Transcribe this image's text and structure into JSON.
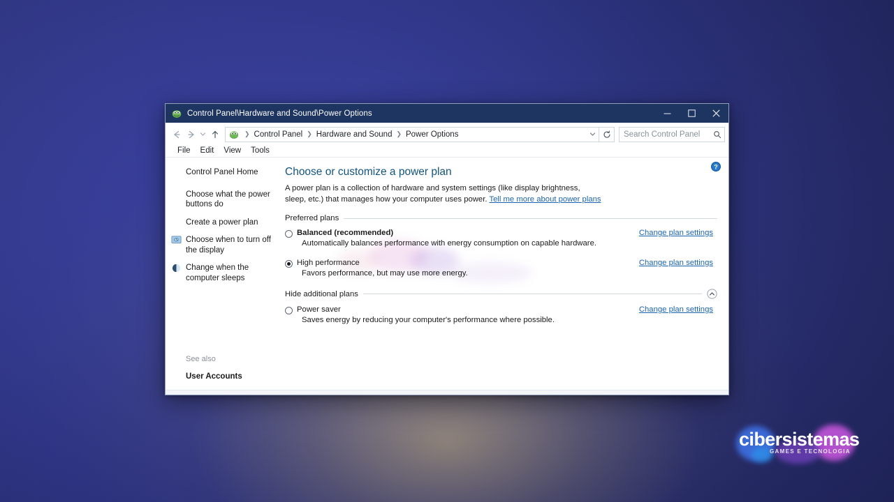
{
  "window": {
    "title": "Control Panel\\Hardware and Sound\\Power Options",
    "minimize_label": "─",
    "maximize_label": "☐",
    "close_label": "✕",
    "icon": "control-panel-icon"
  },
  "navigation": {
    "back": "←",
    "forward": "→",
    "recent": "∨",
    "up": "↑",
    "breadcrumb": [
      {
        "label": "Control Panel"
      },
      {
        "label": "Hardware and Sound"
      },
      {
        "label": "Power Options"
      }
    ],
    "separator": "❯",
    "address_dropdown": "∨",
    "refresh": "↻"
  },
  "search": {
    "placeholder": "Search Control Panel",
    "icon": "search-icon"
  },
  "menubar": [
    {
      "label": "File"
    },
    {
      "label": "Edit"
    },
    {
      "label": "View"
    },
    {
      "label": "Tools"
    }
  ],
  "sidebar": {
    "home": "Control Panel Home",
    "items": [
      {
        "label": "Choose what the power buttons do",
        "icon": "none"
      },
      {
        "label": "Create a power plan",
        "icon": "none"
      },
      {
        "label": "Choose when to turn off the display",
        "icon": "display-icon"
      },
      {
        "label": "Change when the computer sleeps",
        "icon": "sleep-moon-icon"
      }
    ],
    "see_also_label": "See also",
    "see_also_items": [
      {
        "label": "User Accounts"
      }
    ]
  },
  "main": {
    "help_icon": "help-question-icon",
    "title": "Choose or customize a power plan",
    "description_part1": "A power plan is a collection of hardware and system settings (like display brightness, sleep, etc.) that manages how your computer uses power. ",
    "description_link": "Tell me more about power plans",
    "preferred_section_label": "Preferred plans",
    "additional_section_label": "Hide additional plans",
    "collapse_icon": "chevron-up-circle-icon",
    "change_link_label": "Change plan settings",
    "preferred_plans": [
      {
        "name": "Balanced (recommended)",
        "description": "Automatically balances performance with energy consumption on capable hardware.",
        "selected": false,
        "bold": true,
        "link": "Change plan settings"
      },
      {
        "name": "High performance",
        "description": "Favors performance, but may use more energy.",
        "selected": true,
        "bold": false,
        "link": "Change plan settings"
      }
    ],
    "additional_plans": [
      {
        "name": "Power saver",
        "description": "Saves energy by reducing your computer's performance where possible.",
        "selected": false,
        "bold": false,
        "link": "Change plan settings"
      }
    ]
  },
  "watermark": {
    "brand": "cibersistemas",
    "tagline": "GAMES E TECNOLOGIA"
  },
  "colors": {
    "titlebar": "#1e3561",
    "link": "#1c64ad",
    "heading": "#12547e",
    "desktop_blue": "#343c93"
  }
}
